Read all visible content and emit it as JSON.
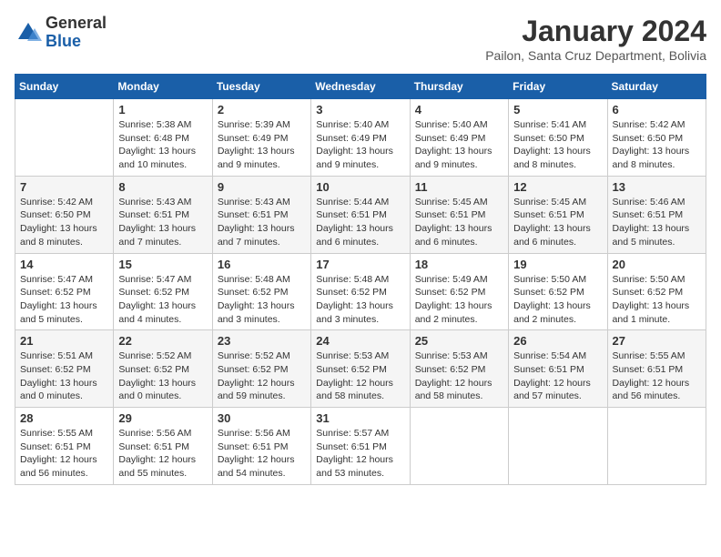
{
  "header": {
    "logo": {
      "general": "General",
      "blue": "Blue"
    },
    "title": "January 2024",
    "location": "Pailon, Santa Cruz Department, Bolivia"
  },
  "calendar": {
    "days_of_week": [
      "Sunday",
      "Monday",
      "Tuesday",
      "Wednesday",
      "Thursday",
      "Friday",
      "Saturday"
    ],
    "weeks": [
      [
        {
          "day": "",
          "info": ""
        },
        {
          "day": "1",
          "info": "Sunrise: 5:38 AM\nSunset: 6:48 PM\nDaylight: 13 hours\nand 10 minutes."
        },
        {
          "day": "2",
          "info": "Sunrise: 5:39 AM\nSunset: 6:49 PM\nDaylight: 13 hours\nand 9 minutes."
        },
        {
          "day": "3",
          "info": "Sunrise: 5:40 AM\nSunset: 6:49 PM\nDaylight: 13 hours\nand 9 minutes."
        },
        {
          "day": "4",
          "info": "Sunrise: 5:40 AM\nSunset: 6:49 PM\nDaylight: 13 hours\nand 9 minutes."
        },
        {
          "day": "5",
          "info": "Sunrise: 5:41 AM\nSunset: 6:50 PM\nDaylight: 13 hours\nand 8 minutes."
        },
        {
          "day": "6",
          "info": "Sunrise: 5:42 AM\nSunset: 6:50 PM\nDaylight: 13 hours\nand 8 minutes."
        }
      ],
      [
        {
          "day": "7",
          "info": "Sunrise: 5:42 AM\nSunset: 6:50 PM\nDaylight: 13 hours\nand 8 minutes."
        },
        {
          "day": "8",
          "info": "Sunrise: 5:43 AM\nSunset: 6:51 PM\nDaylight: 13 hours\nand 7 minutes."
        },
        {
          "day": "9",
          "info": "Sunrise: 5:43 AM\nSunset: 6:51 PM\nDaylight: 13 hours\nand 7 minutes."
        },
        {
          "day": "10",
          "info": "Sunrise: 5:44 AM\nSunset: 6:51 PM\nDaylight: 13 hours\nand 6 minutes."
        },
        {
          "day": "11",
          "info": "Sunrise: 5:45 AM\nSunset: 6:51 PM\nDaylight: 13 hours\nand 6 minutes."
        },
        {
          "day": "12",
          "info": "Sunrise: 5:45 AM\nSunset: 6:51 PM\nDaylight: 13 hours\nand 6 minutes."
        },
        {
          "day": "13",
          "info": "Sunrise: 5:46 AM\nSunset: 6:51 PM\nDaylight: 13 hours\nand 5 minutes."
        }
      ],
      [
        {
          "day": "14",
          "info": "Sunrise: 5:47 AM\nSunset: 6:52 PM\nDaylight: 13 hours\nand 5 minutes."
        },
        {
          "day": "15",
          "info": "Sunrise: 5:47 AM\nSunset: 6:52 PM\nDaylight: 13 hours\nand 4 minutes."
        },
        {
          "day": "16",
          "info": "Sunrise: 5:48 AM\nSunset: 6:52 PM\nDaylight: 13 hours\nand 3 minutes."
        },
        {
          "day": "17",
          "info": "Sunrise: 5:48 AM\nSunset: 6:52 PM\nDaylight: 13 hours\nand 3 minutes."
        },
        {
          "day": "18",
          "info": "Sunrise: 5:49 AM\nSunset: 6:52 PM\nDaylight: 13 hours\nand 2 minutes."
        },
        {
          "day": "19",
          "info": "Sunrise: 5:50 AM\nSunset: 6:52 PM\nDaylight: 13 hours\nand 2 minutes."
        },
        {
          "day": "20",
          "info": "Sunrise: 5:50 AM\nSunset: 6:52 PM\nDaylight: 13 hours\nand 1 minute."
        }
      ],
      [
        {
          "day": "21",
          "info": "Sunrise: 5:51 AM\nSunset: 6:52 PM\nDaylight: 13 hours\nand 0 minutes."
        },
        {
          "day": "22",
          "info": "Sunrise: 5:52 AM\nSunset: 6:52 PM\nDaylight: 13 hours\nand 0 minutes."
        },
        {
          "day": "23",
          "info": "Sunrise: 5:52 AM\nSunset: 6:52 PM\nDaylight: 12 hours\nand 59 minutes."
        },
        {
          "day": "24",
          "info": "Sunrise: 5:53 AM\nSunset: 6:52 PM\nDaylight: 12 hours\nand 58 minutes."
        },
        {
          "day": "25",
          "info": "Sunrise: 5:53 AM\nSunset: 6:52 PM\nDaylight: 12 hours\nand 58 minutes."
        },
        {
          "day": "26",
          "info": "Sunrise: 5:54 AM\nSunset: 6:51 PM\nDaylight: 12 hours\nand 57 minutes."
        },
        {
          "day": "27",
          "info": "Sunrise: 5:55 AM\nSunset: 6:51 PM\nDaylight: 12 hours\nand 56 minutes."
        }
      ],
      [
        {
          "day": "28",
          "info": "Sunrise: 5:55 AM\nSunset: 6:51 PM\nDaylight: 12 hours\nand 56 minutes."
        },
        {
          "day": "29",
          "info": "Sunrise: 5:56 AM\nSunset: 6:51 PM\nDaylight: 12 hours\nand 55 minutes."
        },
        {
          "day": "30",
          "info": "Sunrise: 5:56 AM\nSunset: 6:51 PM\nDaylight: 12 hours\nand 54 minutes."
        },
        {
          "day": "31",
          "info": "Sunrise: 5:57 AM\nSunset: 6:51 PM\nDaylight: 12 hours\nand 53 minutes."
        },
        {
          "day": "",
          "info": ""
        },
        {
          "day": "",
          "info": ""
        },
        {
          "day": "",
          "info": ""
        }
      ]
    ]
  }
}
